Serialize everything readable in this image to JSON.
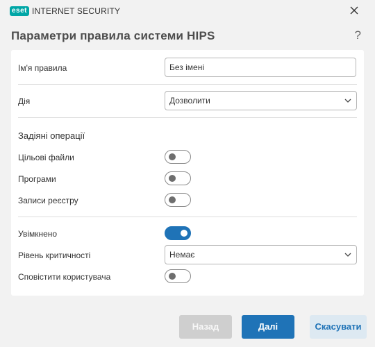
{
  "window": {
    "brand_badge": "eset",
    "brand_name": "INTERNET SECURITY",
    "close_icon": "close-icon"
  },
  "header": {
    "title": "Параметри правила системи HIPS",
    "help_label": "?"
  },
  "form": {
    "rule_name_label": "Ім'я правила",
    "rule_name_value": "Без імені",
    "action_label": "Дія",
    "action_value": "Дозволити",
    "operations_title": "Задіяні операції",
    "target_files_label": "Цільові файли",
    "target_files_on": false,
    "apps_label": "Програми",
    "apps_on": false,
    "registry_label": "Записи реєстру",
    "registry_on": false,
    "enabled_label": "Увімкнено",
    "enabled_on": true,
    "severity_label": "Рівень критичності",
    "severity_value": "Немає",
    "notify_label": "Сповістити користувача",
    "notify_on": false
  },
  "buttons": {
    "back": "Назад",
    "next": "Далі",
    "cancel": "Скасувати"
  },
  "colors": {
    "accent": "#1f73b7",
    "brand": "#00a6a6",
    "disabled": "#cfcfcf"
  }
}
